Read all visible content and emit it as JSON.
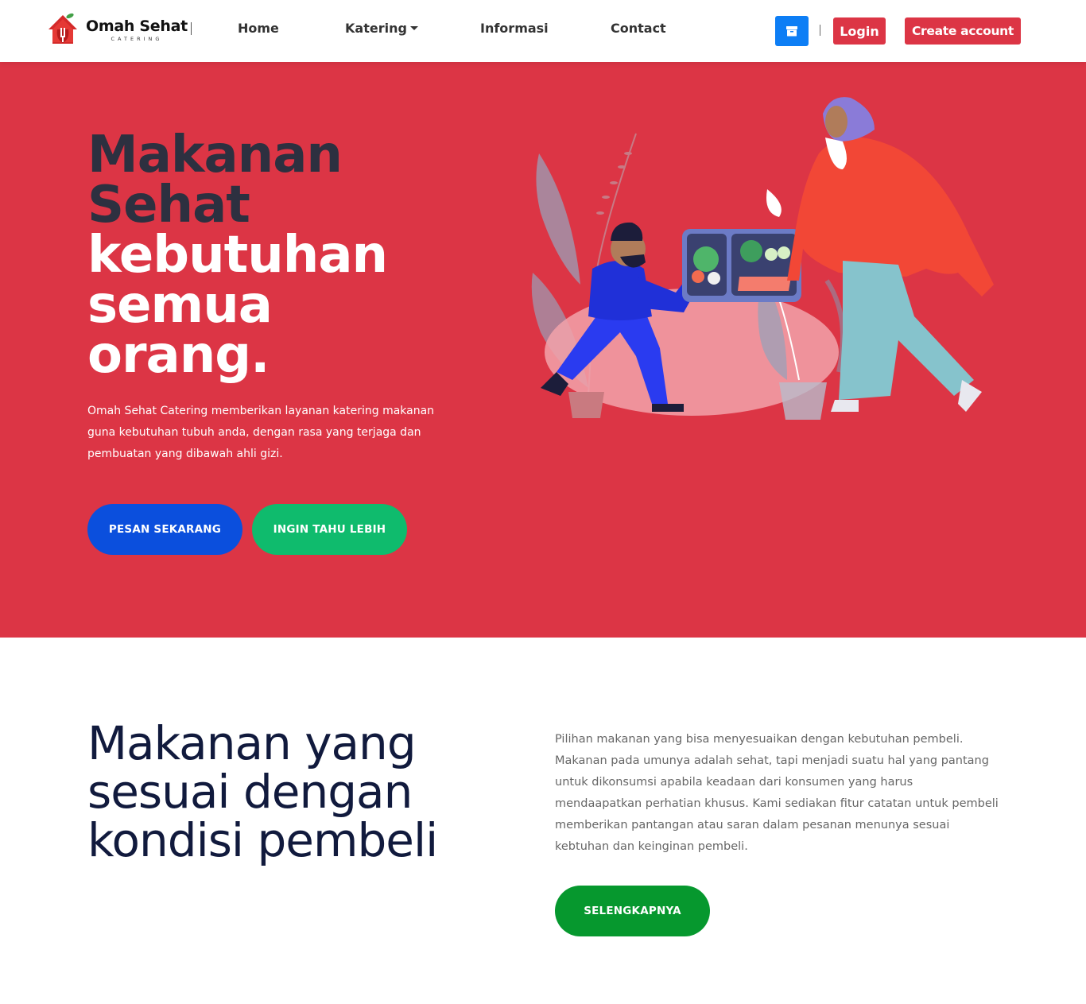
{
  "navbar": {
    "brand_name": "Omah Sehat",
    "brand_sub": "CATERING",
    "links": [
      {
        "label": "Home"
      },
      {
        "label": "Katering"
      },
      {
        "label": "Informasi"
      },
      {
        "label": "Contact"
      }
    ],
    "login_label": "Login",
    "create_account_label": "Create account"
  },
  "hero": {
    "title_dark_1": "Makanan",
    "title_dark_2": "Sehat",
    "title_light_1": "kebutuhan",
    "title_light_2": "semua",
    "title_light_3": "orang.",
    "description": "Omah Sehat Catering memberikan layanan katering makanan guna kebutuhan tubuh anda, dengan rasa yang terjaga dan pembuatan yang dibawah ahli gizi.",
    "btn_order": "PESAN SEKARANG",
    "btn_more": "INGIN TAHU LEBIH"
  },
  "section2": {
    "title_1": "Makanan yang",
    "title_2": "sesuai dengan",
    "title_3": "kondisi pembeli",
    "description": "Pilihan makanan yang bisa menyesuaikan dengan kebutuhan pembeli. Makanan pada umunya adalah sehat, tapi menjadi suatu hal yang pantang untuk dikonsumsi apabila keadaan dari konsumen yang harus mendaapatkan perhatian khusus. Kami sediakan fitur catatan untuk pembeli memberikan pantangan atau saran dalam pesanan menunya sesuai kebtuhan dan keinginan pembeli.",
    "btn_label": "SELENGKAPNYA"
  },
  "colors": {
    "hero_bg": "#dc3545",
    "primary_blue": "#0b4fdd",
    "green": "#0fbb6d",
    "dark_green": "#06982e",
    "cart_blue": "#0d7ef5",
    "heading_navy": "#111a3d"
  },
  "icons": {
    "cart": "archive-box-icon",
    "logo": "house-fork-apple-icon"
  }
}
